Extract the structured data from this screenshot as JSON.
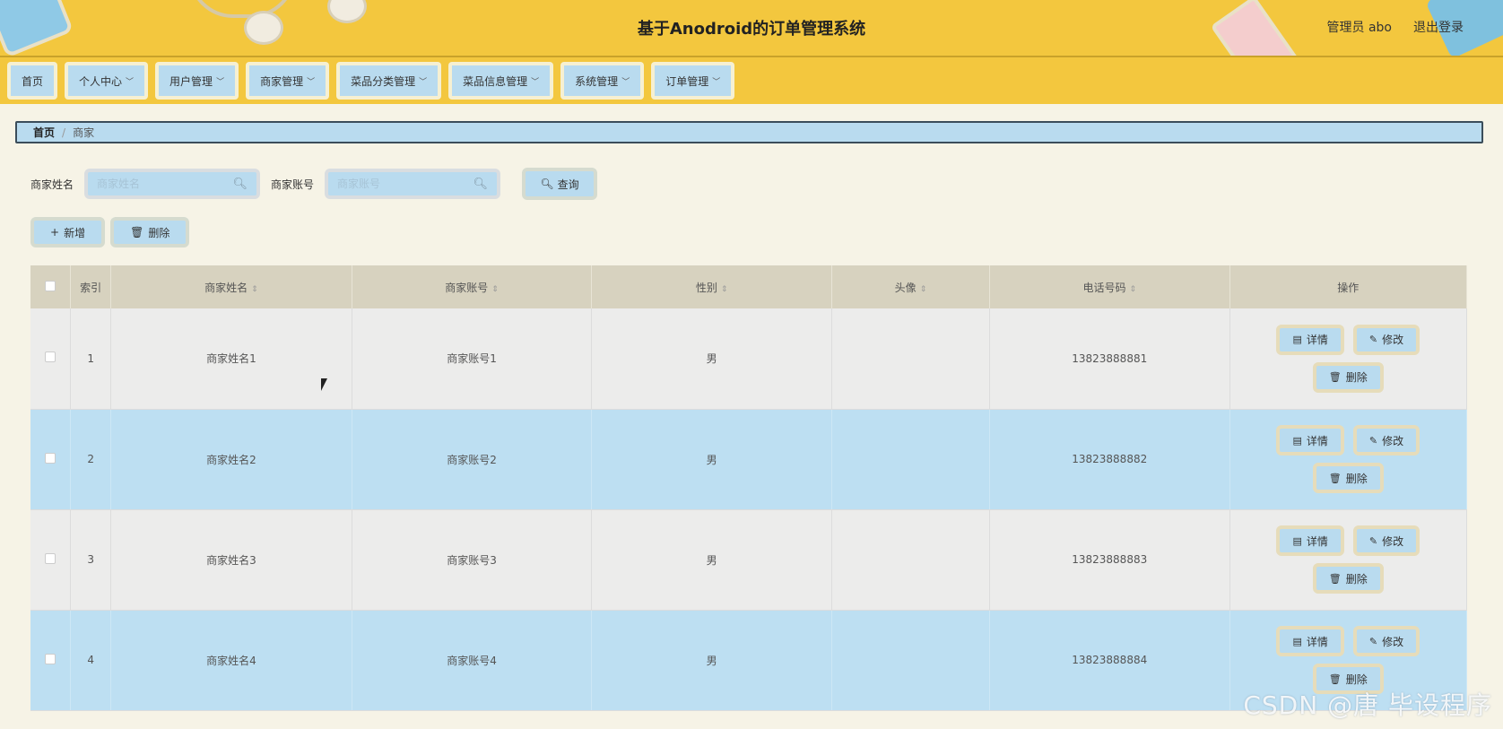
{
  "header": {
    "title": "基于Anodroid的订单管理系统",
    "user": "管理员 abo",
    "logout": "退出登录"
  },
  "nav": [
    {
      "label": "首页",
      "has_menu": false
    },
    {
      "label": "个人中心",
      "has_menu": true
    },
    {
      "label": "用户管理",
      "has_menu": true
    },
    {
      "label": "商家管理",
      "has_menu": true
    },
    {
      "label": "菜品分类管理",
      "has_menu": true
    },
    {
      "label": "菜品信息管理",
      "has_menu": true
    },
    {
      "label": "系统管理",
      "has_menu": true
    },
    {
      "label": "订单管理",
      "has_menu": true
    }
  ],
  "breadcrumb": {
    "home": "首页",
    "separator": "/",
    "current": "商家"
  },
  "search": {
    "name_label": "商家姓名",
    "name_placeholder": "商家姓名",
    "account_label": "商家账号",
    "account_placeholder": "商家账号",
    "query_label": "查询"
  },
  "actions": {
    "add_label": "新增",
    "delete_label": "删除"
  },
  "table": {
    "columns": [
      "索引",
      "商家姓名",
      "商家账号",
      "性别",
      "头像",
      "电话号码",
      "操作"
    ],
    "rows": [
      {
        "index": "1",
        "name": "商家姓名1",
        "account": "商家账号1",
        "gender": "男",
        "avatar": "",
        "phone": "13823888881"
      },
      {
        "index": "2",
        "name": "商家姓名2",
        "account": "商家账号2",
        "gender": "男",
        "avatar": "",
        "phone": "13823888882"
      },
      {
        "index": "3",
        "name": "商家姓名3",
        "account": "商家账号3",
        "gender": "男",
        "avatar": "",
        "phone": "13823888883"
      },
      {
        "index": "4",
        "name": "商家姓名4",
        "account": "商家账号4",
        "gender": "男",
        "avatar": "",
        "phone": "13823888884"
      }
    ],
    "row_actions": {
      "detail": "详情",
      "edit": "修改",
      "delete": "删除"
    }
  },
  "watermark": "CSDN @唐 毕设程序",
  "colors": {
    "header_bg": "#f3c73e",
    "button_bg": "#b9dbef",
    "row_highlight": "#bddff2",
    "page_bg": "#f6f3e6"
  }
}
